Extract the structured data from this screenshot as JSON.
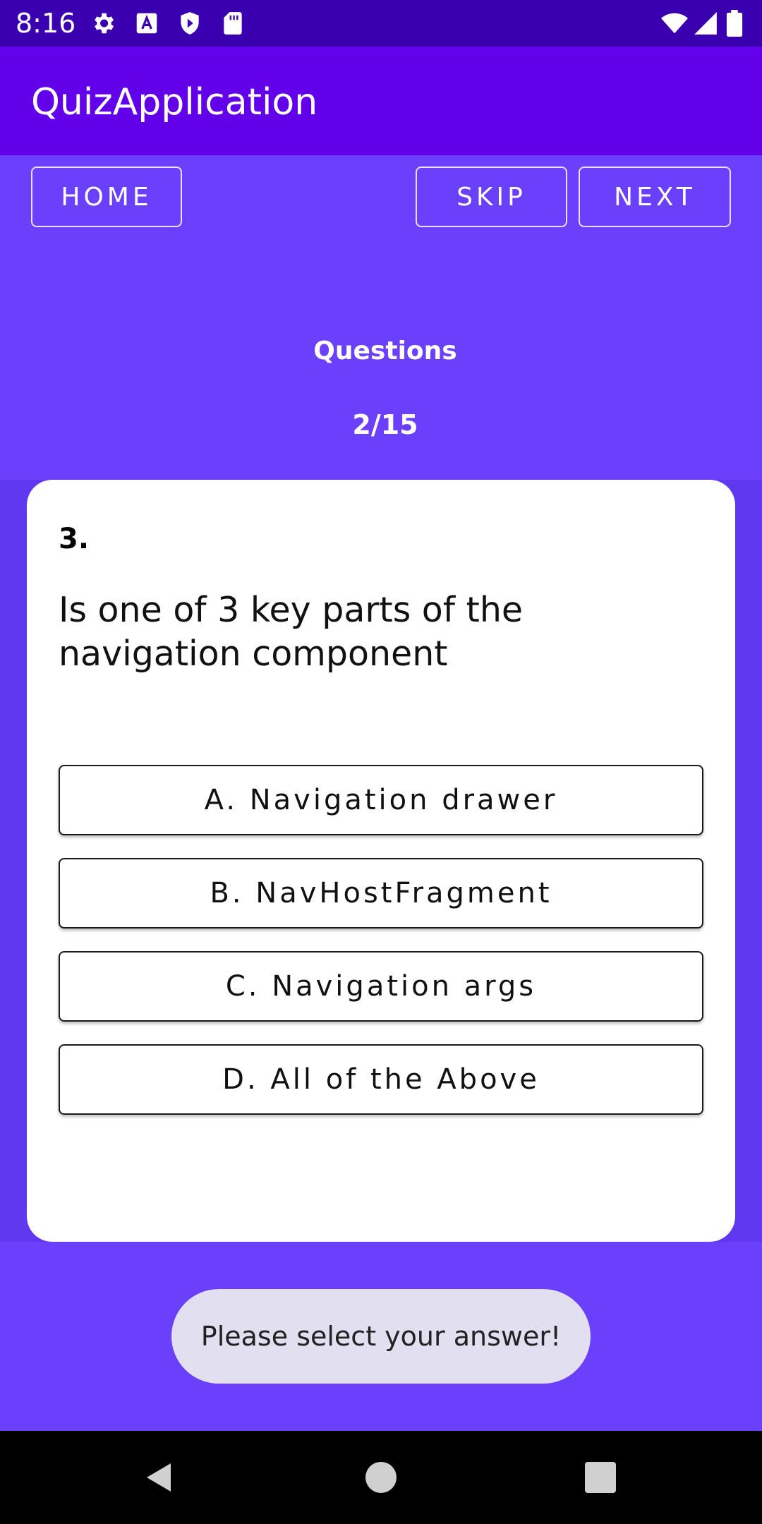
{
  "status_bar": {
    "time": "8:16",
    "icons": [
      "gear-icon",
      "font-a-icon",
      "play-shield-icon",
      "sd-card-icon",
      "wifi-icon",
      "signal-icon",
      "battery-icon"
    ]
  },
  "app_bar": {
    "title": "QuizApplication"
  },
  "toolbar": {
    "home_label": "HOME",
    "skip_label": "SKIP",
    "next_label": "NEXT"
  },
  "quiz": {
    "questions_label": "Questions",
    "progress": "2/15",
    "question_number": "3.",
    "question_text": "Is one of 3 key parts of the navigation component",
    "options": [
      {
        "label": "A. Navigation drawer"
      },
      {
        "label": "B. NavHostFragment"
      },
      {
        "label": "C. Navigation args"
      },
      {
        "label": "D. All of the Above"
      }
    ]
  },
  "toast": {
    "message": "Please select your answer!"
  },
  "nav_bar": {
    "icons": [
      "back-icon",
      "home-icon",
      "recents-icon"
    ]
  },
  "colors": {
    "status_bar": "#3a00b0",
    "app_bar": "#6200ea",
    "background": "#6a40fd",
    "card": "#ffffff",
    "toast": "#e1dff0"
  }
}
